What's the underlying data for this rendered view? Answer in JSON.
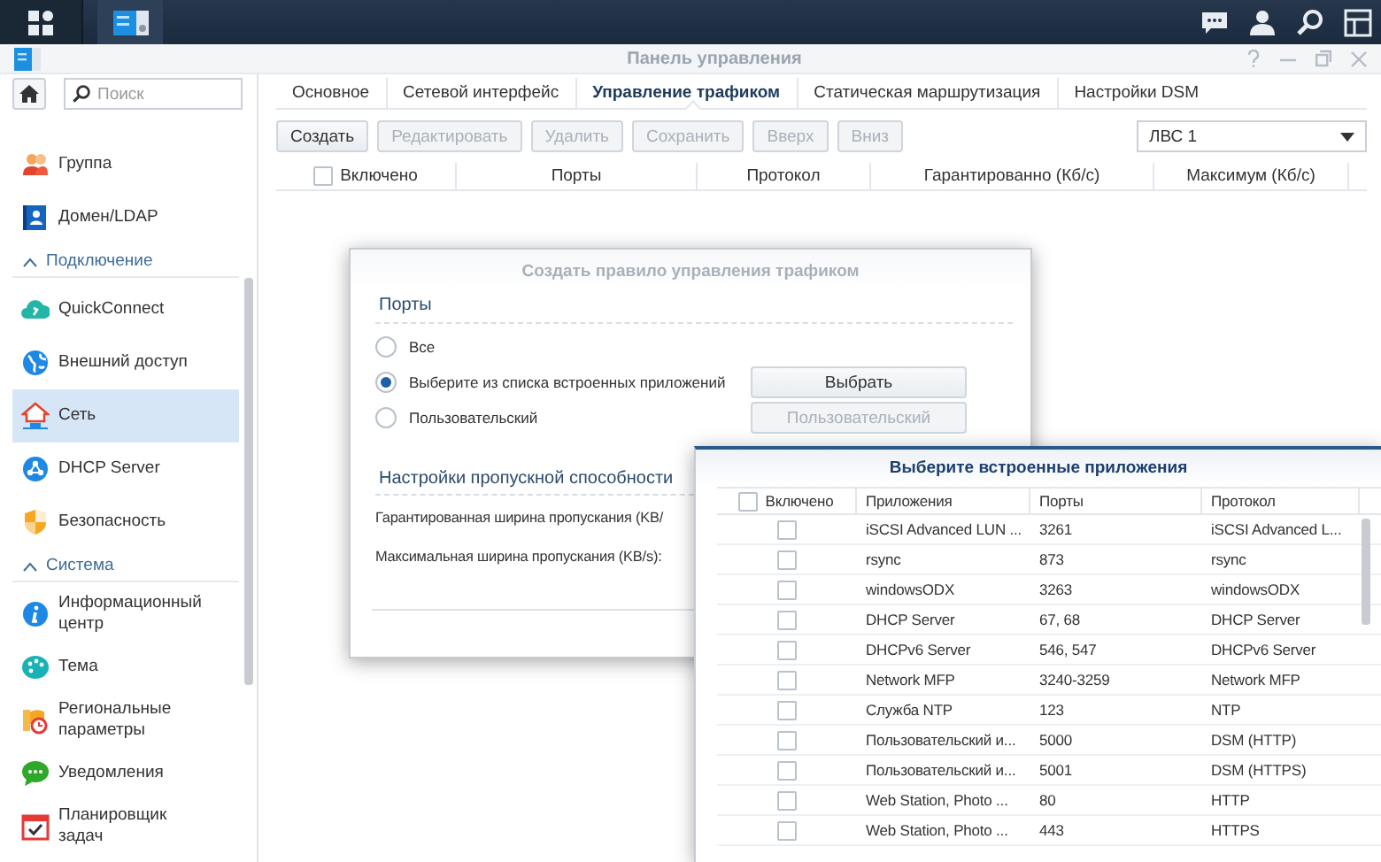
{
  "window": {
    "title": "Панель управления"
  },
  "search": {
    "placeholder": "Поиск"
  },
  "sidebar": {
    "items": [
      {
        "kind": "item",
        "label": "Группа",
        "selected": false
      },
      {
        "kind": "item",
        "label": "Домен/LDAP",
        "selected": false
      },
      {
        "kind": "section",
        "label": "Подключение",
        "expanded": true
      },
      {
        "kind": "item",
        "label": "QuickConnect",
        "selected": false
      },
      {
        "kind": "item",
        "label": "Внешний доступ",
        "selected": false
      },
      {
        "kind": "item",
        "label": "Сеть",
        "selected": true
      },
      {
        "kind": "item",
        "label": "DHCP Server",
        "selected": false
      },
      {
        "kind": "item",
        "label": "Безопасность",
        "selected": false
      },
      {
        "kind": "section",
        "label": "Система",
        "expanded": true
      },
      {
        "kind": "item",
        "label": "Информационный центр",
        "selected": false
      },
      {
        "kind": "item",
        "label": "Тема",
        "selected": false
      },
      {
        "kind": "item",
        "label": "Региональные параметры",
        "selected": false
      },
      {
        "kind": "item",
        "label": "Уведомления",
        "selected": false
      },
      {
        "kind": "item",
        "label": "Планировщик задач",
        "selected": false
      }
    ]
  },
  "tabs": [
    {
      "label": "Основное",
      "selected": false
    },
    {
      "label": "Сетевой интерфейс",
      "selected": false
    },
    {
      "label": "Управление трафиком",
      "selected": true
    },
    {
      "label": "Статическая маршрутизация",
      "selected": false
    },
    {
      "label": "Настройки DSM",
      "selected": false
    }
  ],
  "toolbar": {
    "buttons": [
      {
        "label": "Создать",
        "disabled": false
      },
      {
        "label": "Редактировать",
        "disabled": true
      },
      {
        "label": "Удалить",
        "disabled": true
      },
      {
        "label": "Сохранить",
        "disabled": true
      },
      {
        "label": "Вверх",
        "disabled": true
      },
      {
        "label": "Вниз",
        "disabled": true
      }
    ],
    "interface_select": {
      "value": "ЛВС 1"
    }
  },
  "rules_table": {
    "select_all_checked": false,
    "columns": [
      "Включено",
      "Порты",
      "Протокол",
      "Гарантированно (Кб/с)",
      "Максимум (Кб/с)"
    ]
  },
  "rule_dialog": {
    "title": "Создать правило управления трафиком",
    "ports_heading": "Порты",
    "port_options": [
      {
        "label": "Все",
        "selected": false
      },
      {
        "label": "Выберите из списка встроенных приложений",
        "selected": true
      },
      {
        "label": "Пользовательский",
        "selected": false
      }
    ],
    "buttons": [
      {
        "label": "Выбрать",
        "disabled": false
      },
      {
        "label": "Пользовательский",
        "disabled": true
      }
    ],
    "bandwidth_heading": "Настройки пропускной способности",
    "fields": [
      "Гарантированная ширина пропускания (KB/",
      "Максимальная ширина пропускания (KB/s):"
    ]
  },
  "apps_dialog": {
    "title": "Выберите встроенные приложения",
    "select_all_checked": false,
    "columns": [
      "Включено",
      "Приложения",
      "Порты",
      "Протокол"
    ],
    "rows": [
      {
        "checked": false,
        "application": "iSCSI Advanced LUN ...",
        "ports": "3261",
        "protocol": "iSCSI Advanced L..."
      },
      {
        "checked": false,
        "application": "rsync",
        "ports": "873",
        "protocol": "rsync"
      },
      {
        "checked": false,
        "application": "windowsODX",
        "ports": "3263",
        "protocol": "windowsODX"
      },
      {
        "checked": false,
        "application": "DHCP Server",
        "ports": "67, 68",
        "protocol": "DHCP Server"
      },
      {
        "checked": false,
        "application": "DHCPv6 Server",
        "ports": "546, 547",
        "protocol": "DHCPv6 Server"
      },
      {
        "checked": false,
        "application": "Network MFP",
        "ports": "3240-3259",
        "protocol": "Network MFP"
      },
      {
        "checked": false,
        "application": "Служба NTP",
        "ports": "123",
        "protocol": "NTP"
      },
      {
        "checked": false,
        "application": "Пользовательский и...",
        "ports": "5000",
        "protocol": "DSM (HTTP)"
      },
      {
        "checked": false,
        "application": "Пользовательский и...",
        "ports": "5001",
        "protocol": "DSM (HTTPS)"
      },
      {
        "checked": false,
        "application": "Web Station, Photo ...",
        "ports": "80",
        "protocol": "HTTP"
      },
      {
        "checked": false,
        "application": "Web Station, Photo ...",
        "ports": "443",
        "protocol": "HTTPS"
      }
    ]
  }
}
